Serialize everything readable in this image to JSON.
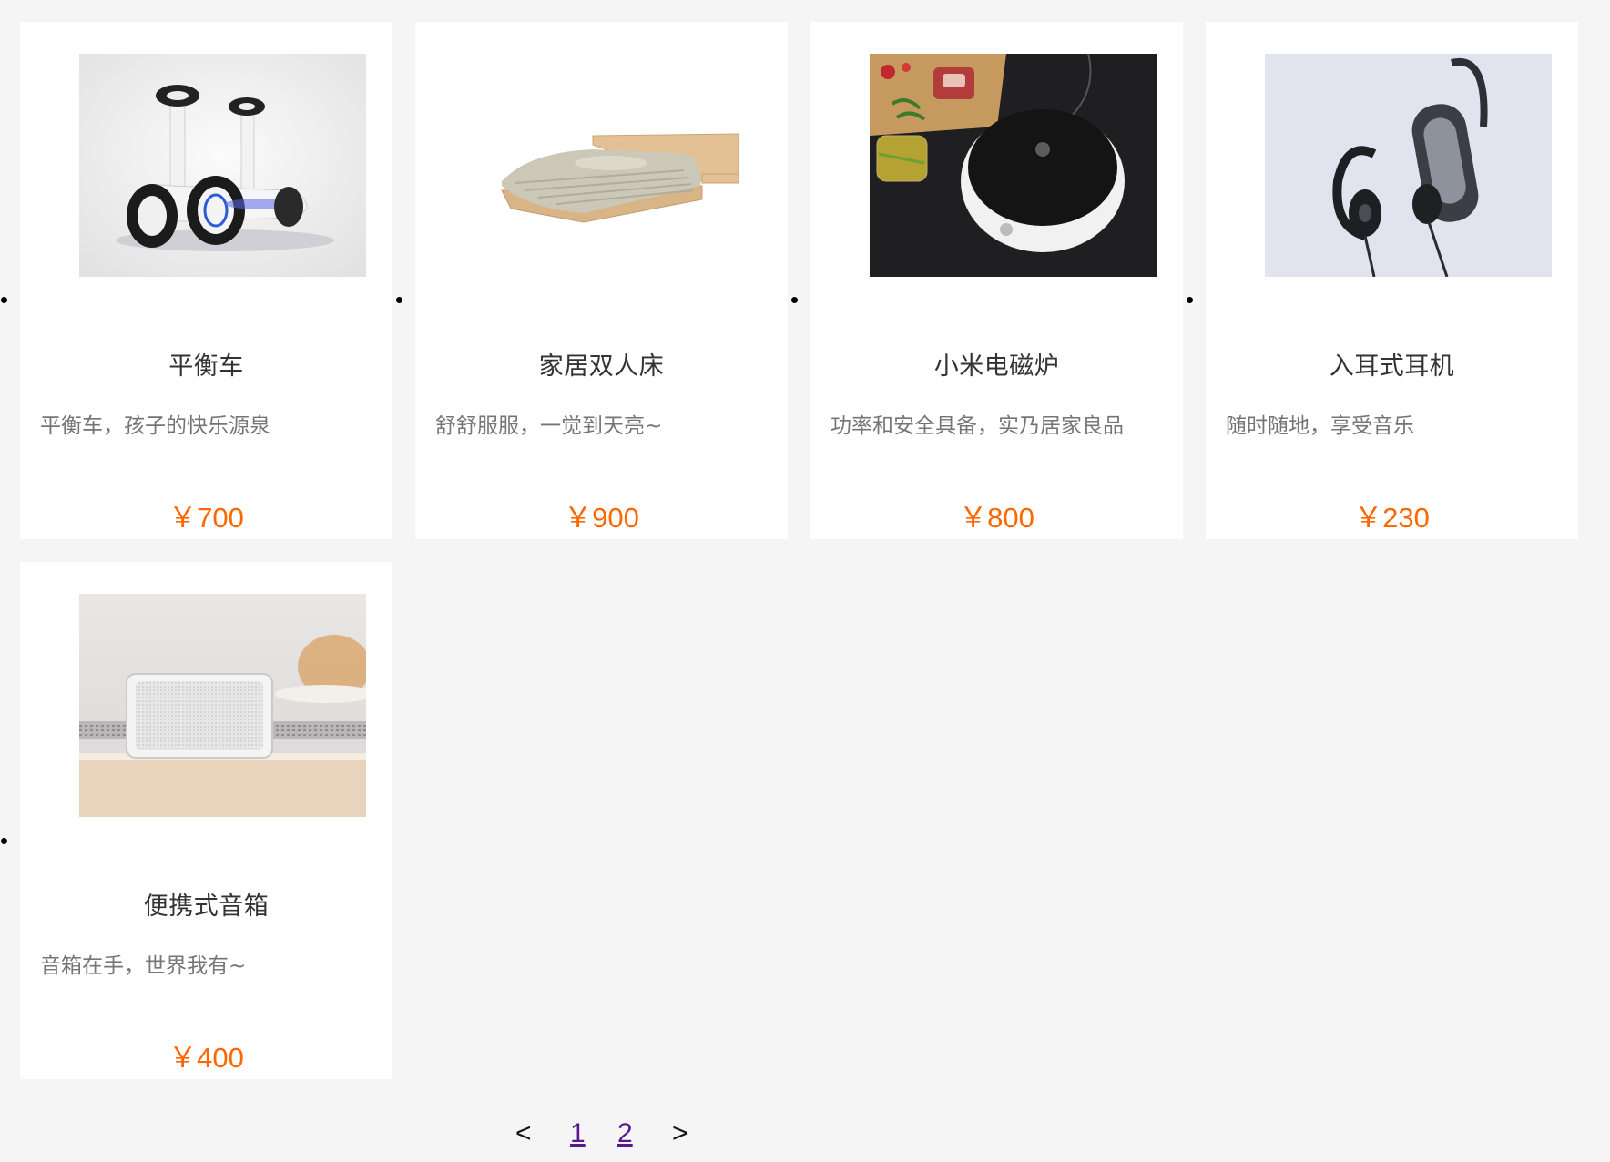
{
  "products": [
    {
      "name": "平衡车",
      "desc": "平衡车，孩子的快乐源泉",
      "price": "￥700",
      "image": "self-balancing-scooter-image"
    },
    {
      "name": "家居双人床",
      "desc": "舒舒服服，一觉到天亮~",
      "price": "￥900",
      "image": "double-bed-image"
    },
    {
      "name": "小米电磁炉",
      "desc": "功率和安全具备，实乃居家良品",
      "price": "￥800",
      "image": "induction-cooker-image"
    },
    {
      "name": "入耳式耳机",
      "desc": "随时随地，享受音乐",
      "price": "￥230",
      "image": "earphones-image"
    },
    {
      "name": "便携式音箱",
      "desc": "音箱在手，世界我有~",
      "price": "￥400",
      "image": "portable-speaker-image"
    }
  ],
  "pagination": {
    "prev": "<",
    "pages": [
      "1",
      "2"
    ],
    "next": ">"
  },
  "colors": {
    "background": "#f5f5f5",
    "card": "#ffffff",
    "price": "#ff6700",
    "link_visited": "#551a8b"
  }
}
